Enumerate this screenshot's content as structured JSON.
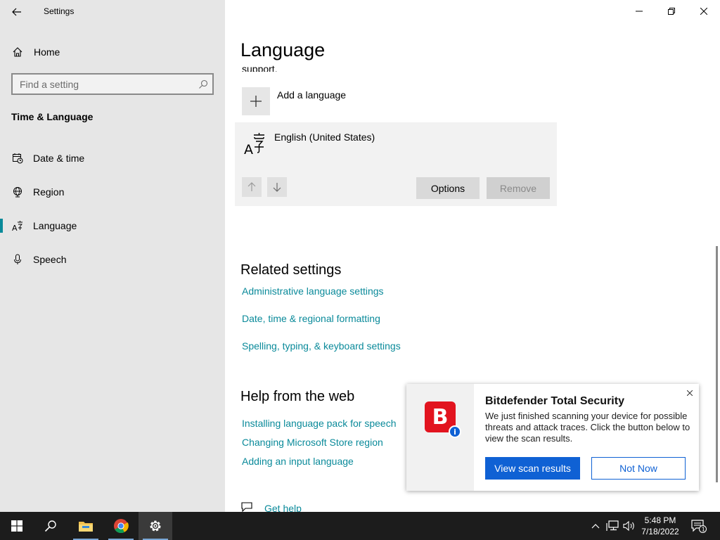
{
  "window": {
    "app_title": "Settings",
    "controls": {
      "minimize": "minimize-icon",
      "maximize": "restore-icon",
      "close": "close-icon"
    }
  },
  "sidebar": {
    "home_label": "Home",
    "search_placeholder": "Find a setting",
    "section_title": "Time & Language",
    "items": [
      {
        "label": "Date & time",
        "icon": "calendar-clock-icon",
        "active": false
      },
      {
        "label": "Region",
        "icon": "globe-icon",
        "active": false
      },
      {
        "label": "Language",
        "icon": "language-icon",
        "active": true
      },
      {
        "label": "Speech",
        "icon": "microphone-icon",
        "active": false
      }
    ]
  },
  "main": {
    "page_title": "Language",
    "support_text": "support.",
    "add_language_label": "Add a language",
    "language_card": {
      "name": "English (United States)",
      "options_label": "Options",
      "remove_label": "Remove"
    },
    "related_settings": {
      "heading": "Related settings",
      "links": [
        "Administrative language settings",
        "Date, time & regional formatting",
        "Spelling, typing, & keyboard settings"
      ]
    },
    "help": {
      "heading": "Help from the web",
      "links": [
        "Installing language pack for speech",
        "Changing Microsoft Store region",
        "Adding an input language"
      ],
      "get_help_label": "Get help"
    }
  },
  "toast": {
    "title": "Bitdefender Total Security",
    "body": "We just finished scanning your device for possible threats and attack traces. Click the button below to view the scan results.",
    "primary_button": "View scan results",
    "secondary_button": "Not Now",
    "logo_letter": "B",
    "badge_letter": "i",
    "accent_color": "#0f61d4",
    "brand_color": "#e2141f"
  },
  "taskbar": {
    "time": "5:48 PM",
    "date": "7/18/2022",
    "notification_count": "1",
    "apps": [
      "start-icon",
      "search-icon",
      "file-explorer-icon",
      "chrome-icon",
      "settings-icon"
    ]
  },
  "colors": {
    "link": "#0a8a9a",
    "sidebar_bg": "#e6e6e6",
    "taskbar_bg": "#1c1c1c"
  }
}
